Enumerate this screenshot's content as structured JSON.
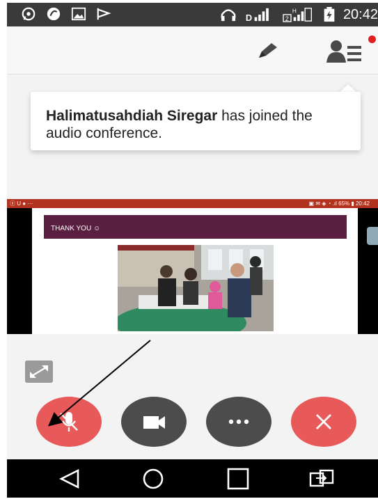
{
  "status_bar": {
    "time": "20:42",
    "icons": [
      "whatsapp-icon",
      "chat-icon",
      "image-icon",
      "flag-icon",
      "headset-icon",
      "signal-icon",
      "signal-h-icon",
      "battery-icon"
    ]
  },
  "toolbar": {
    "icons": [
      "pencil-icon",
      "participants-icon"
    ],
    "notification_dot_color": "#e02020"
  },
  "toast": {
    "name": "Halimatusahdiah Siregar",
    "message": " has joined the audio conference."
  },
  "shared_screen": {
    "status_left": "ⓢ U ● ···",
    "status_right": "▣ ✉ ◈ ◔ .ıl 65% ▮ 20:42",
    "slide_title": "THANK YOU ☺"
  },
  "controls": {
    "icons": [
      "expand-icon",
      "mic-muted-icon",
      "video-camera-icon",
      "more-icon",
      "close-icon"
    ],
    "accent_red": "#e85a5a",
    "dark_gray": "#4c4c4c"
  },
  "nav_bar": {
    "icons": [
      "back-icon",
      "home-icon",
      "recents-icon",
      "switch-icon"
    ]
  }
}
